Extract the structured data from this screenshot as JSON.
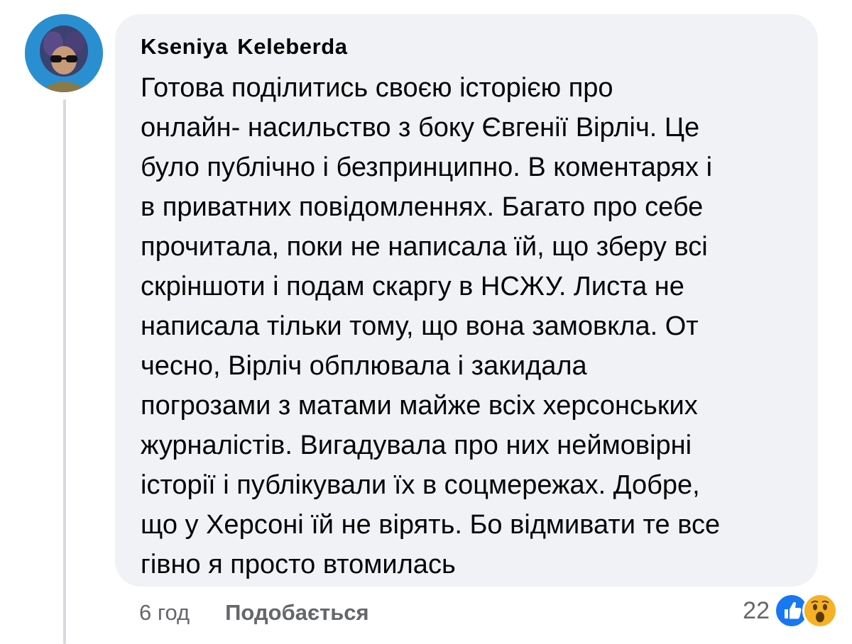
{
  "comment": {
    "author": "Kseniya  Keleberda",
    "lines": [
      "Готова поділитись своєю історією про",
      "онлайн- насильство з боку Євгенії Вірліч. Це",
      "було публічно і безпринципно. В коментарях і",
      "в приватних повідомленнях. Багато про себе",
      "прочитала, поки не написала їй, що зберу всі",
      "скріншоти і подам скаргу в НСЖУ. Листа не",
      "написала тільки тому, що вона замовкла. От",
      "чесно, Вірліч обплювала і закидала",
      "погрозами з матами майже всіх херсонських",
      "журналістів. Вигадувала про них неймовірні",
      "історії і публікували їх в соцмережах. Добре,",
      "що у Херсоні їй не вірять. Бо відмивати те все",
      "гівно я просто втомилась"
    ],
    "timestamp": "6 год",
    "like_label": "Подобається",
    "reaction_count": "22",
    "reactions": [
      "like-icon",
      "wow-icon"
    ]
  },
  "colors": {
    "bubble_bg": "#f0f2f5",
    "meta_text": "#65676b",
    "like_blue": "#1877f2",
    "wow_yellow": "#f7b125"
  }
}
